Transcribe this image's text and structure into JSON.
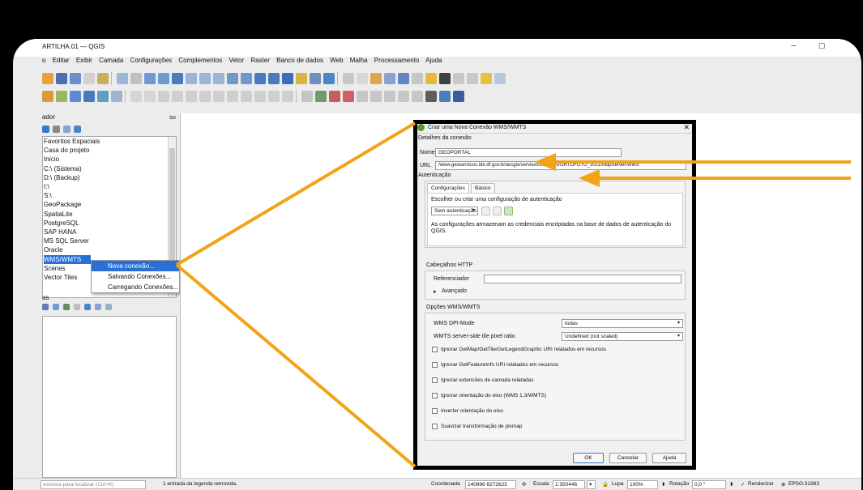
{
  "app": {
    "title": "ARTILHA.01 — QGIS",
    "minimize_icon": "−",
    "maximize_icon": "▢"
  },
  "menu": [
    "o",
    "Editar",
    "Exibir",
    "Camada",
    "Configurações",
    "Complementos",
    "Vetor",
    "Raster",
    "Banco de dados",
    "Web",
    "Malha",
    "Processamento",
    "Ajuda"
  ],
  "browser": {
    "title": "ador",
    "items": [
      "Favoritos Espaciais",
      "Casa do projeto",
      "Início",
      "C:\\ (Sistema)",
      "D:\\ (Backup)",
      "I:\\",
      "S:\\",
      "GeoPackage",
      "SpatiaLite",
      "PostgreSQL",
      "SAP HANA",
      "MS SQL Server",
      "Oracle",
      "WMS/WMTS",
      "Scenes",
      "Vector Tiles"
    ]
  },
  "context_menu": [
    "Nova conexão...",
    "Salvando Conexões...",
    "Carregando Conexões..."
  ],
  "layers_title": "as",
  "dialog": {
    "title": "Criar uma Nova Conexão WMS/WMTS",
    "close_icon": "✕",
    "details_label": "Detalhes da conexão",
    "name_label": "Nome",
    "name_value": "GEOPORTAL",
    "url_label": "URL",
    "url_value": "/www.geoservicos.ide.df.gov.br/arcgis/services/Imagens/ORTOFOTO_2021/MapServer/WMS",
    "auth_label": "Autenticação",
    "tabs": [
      "Configurações",
      "Básico"
    ],
    "auth_hint": "Escolher ou criar uma configuração de autenticação",
    "auth_select": "Sem autenticação",
    "auth_note": "As configurações armazenam as credenciais encriptadas na base de dados de autenticação do QGIS.",
    "http_label": "Cabeçalhos HTTP",
    "referer_label": "Referenciador",
    "advanced_label": "Avançado",
    "wms_label": "Opções WMS/WMTS",
    "dpi_label": "WMS DPI-Mode",
    "dpi_value": "todas",
    "tile_label": "WMTS server-side tile pixel ratio",
    "tile_value": "Undefined (not scaled)",
    "checkboxes": [
      "Ignorar GetMap/GetTile/GetLegendGraphic URI relatados em recursos",
      "Ignorar GetFeatureInfo URI relatados em recursos",
      "Ignorar extensões de camada relatadas",
      "Ignorar orientação do eixo (WMS 1.3/WMTS)",
      "Inverter orientação do eixo",
      "Suavizar transformação de pixmap"
    ],
    "ok": "OK",
    "cancel": "Cancelar",
    "help": "Ajuda"
  },
  "status": {
    "locator": "escreva para localizar (Ctrl+K)",
    "message": "1 entrada da legenda removida.",
    "coord_label": "Coordenada",
    "coord_value": "140896 8272623",
    "scale_label": "Escala",
    "scale_value": "1:350446",
    "lupa_label": "Lupa",
    "lupa_value": "100%",
    "rot_label": "Rotação",
    "rot_value": "0,0 °",
    "render_label": "Renderizar",
    "crs": "EPSG:31983"
  },
  "colors": {
    "annotation": "#F2A316",
    "selection": "#2A6FD6"
  }
}
